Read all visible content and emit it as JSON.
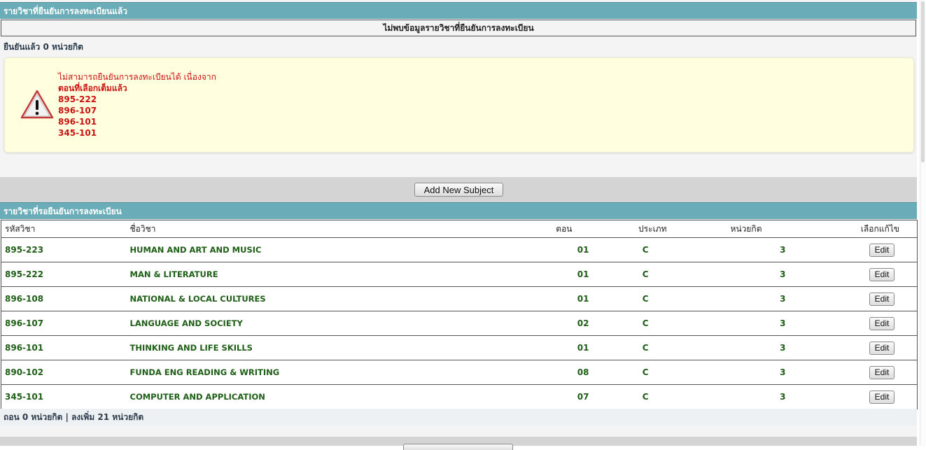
{
  "confirmed_section": {
    "title": "รายวิชาที่ยืนยันการลงทะเบียนแล้ว",
    "empty_message": "ไม่พบข้อมูลรายวิชาที่ยืนยันการลงทะเบียน",
    "summary": "ยืนยันแล้ว 0 หน่วยกิต"
  },
  "warning": {
    "icon": "warning-triangle-icon",
    "lines": [
      "ไม่สามารถยืนยันการลงทะเบียนได้ เนื่องจาก",
      "ตอนที่เลือกเต็มแล้ว",
      "895-222",
      "896-107",
      "896-101",
      "345-101"
    ]
  },
  "actions": {
    "add_subject_label": "Add New Subject"
  },
  "pending_section": {
    "title": "รายวิชาที่รอยืนยันการลงทะเบียน",
    "columns": {
      "code": "รหัสวิชา",
      "name": "ชื่อวิชา",
      "section": "ตอน",
      "type": "ประเภท",
      "credits": "หน่วยกิต",
      "edit": "เลือกแก้ไข"
    },
    "rows": [
      {
        "code": "895-223",
        "name": "HUMAN AND ART AND MUSIC",
        "section": "01",
        "type": "C",
        "credits": "3",
        "edit_label": "Edit"
      },
      {
        "code": "895-222",
        "name": "MAN & LITERATURE",
        "section": "01",
        "type": "C",
        "credits": "3",
        "edit_label": "Edit"
      },
      {
        "code": "896-108",
        "name": "NATIONAL & LOCAL CULTURES",
        "section": "01",
        "type": "C",
        "credits": "3",
        "edit_label": "Edit"
      },
      {
        "code": "896-107",
        "name": "LANGUAGE AND SOCIETY",
        "section": "02",
        "type": "C",
        "credits": "3",
        "edit_label": "Edit"
      },
      {
        "code": "896-101",
        "name": "THINKING AND LIFE SKILLS",
        "section": "01",
        "type": "C",
        "credits": "3",
        "edit_label": "Edit"
      },
      {
        "code": "890-102",
        "name": "FUNDA ENG READING & WRITING",
        "section": "08",
        "type": "C",
        "credits": "3",
        "edit_label": "Edit"
      },
      {
        "code": "345-101",
        "name": "COMPUTER AND APPLICATION",
        "section": "07",
        "type": "C",
        "credits": "3",
        "edit_label": "Edit"
      }
    ],
    "totals": "ถอน 0 หน่วยกิต | ลงเพิ่ม 21 หน่วยกิต"
  },
  "colors": {
    "header_bg": "#6aacb8",
    "warning_bg": "#ffffe0",
    "warning_text": "#cc1111",
    "row_text": "#1f5e17"
  }
}
